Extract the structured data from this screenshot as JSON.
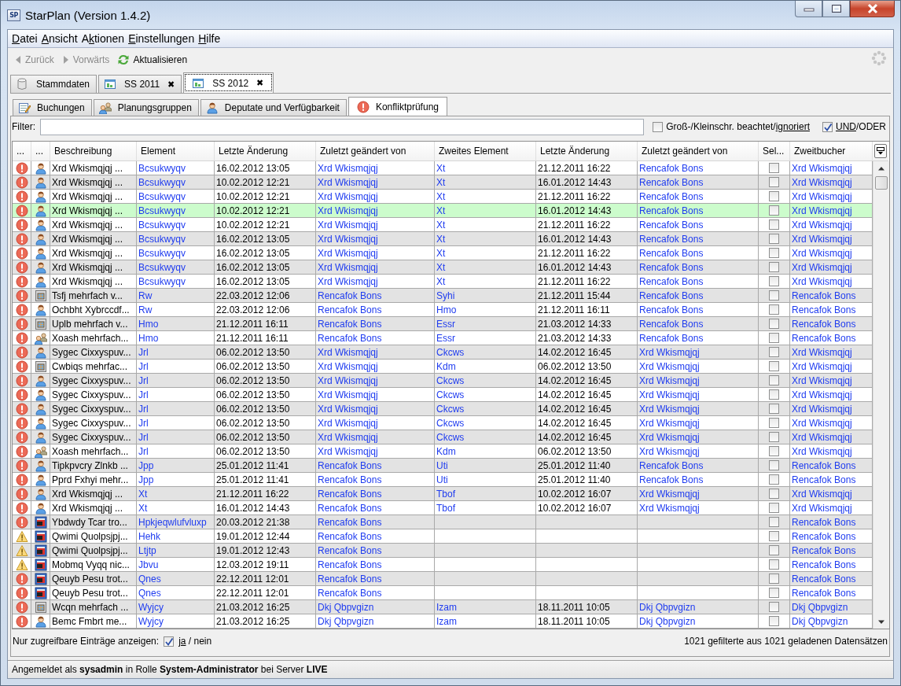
{
  "window": {
    "app_icon_text": "SP",
    "title": "StarPlan (Version 1.4.2)"
  },
  "menu": [
    {
      "parts": [
        {
          "text": "D",
          "underlined": true
        },
        {
          "text": "atei",
          "underlined": false
        }
      ]
    },
    {
      "parts": [
        {
          "text": "A",
          "underlined": true
        },
        {
          "text": "nsicht",
          "underlined": false
        }
      ]
    },
    {
      "parts": [
        {
          "text": "A",
          "underlined": false
        },
        {
          "text": "k",
          "underlined": true
        },
        {
          "text": "tionen",
          "underlined": false
        }
      ]
    },
    {
      "parts": [
        {
          "text": "E",
          "underlined": true
        },
        {
          "text": "instellungen",
          "underlined": false
        }
      ]
    },
    {
      "parts": [
        {
          "text": "H",
          "underlined": true
        },
        {
          "text": "ilfe",
          "underlined": false
        }
      ]
    }
  ],
  "toolbar": [
    {
      "label": "Zurück",
      "disabled": true
    },
    {
      "label": "Vorwärts",
      "disabled": true
    },
    {
      "label": "Aktualisieren",
      "disabled": false
    }
  ],
  "doc_tabs": [
    {
      "label": "Stammdaten",
      "selected": false
    },
    {
      "label": "SS 2011",
      "close": "✖",
      "selected": false
    },
    {
      "label": "SS 2012",
      "close": "✖",
      "selected": true
    }
  ],
  "sub_tabs": [
    {
      "label": "Buchungen",
      "selected": false
    },
    {
      "label": "Planungsgruppen",
      "selected": false
    },
    {
      "label": "Deputate und Verfügbarkeit",
      "selected": false
    },
    {
      "label": "Konfliktprüfung",
      "selected": true
    }
  ],
  "filter": {
    "label": "Filter:",
    "case_option": {
      "checked": false,
      "parts": [
        {
          "text": "Groß-/Kleinschr. beachtet/",
          "underlined": false
        },
        {
          "text": "ignoriert",
          "underlined": true
        }
      ]
    },
    "logic_option": {
      "checked": true,
      "parts": [
        {
          "text": "UND",
          "underlined": true
        },
        {
          "text": "/ODER",
          "underlined": false
        }
      ]
    }
  },
  "table": {
    "columns": [
      "...",
      "...",
      "Beschreibung",
      "Element",
      "Letzte Änderung",
      "Zuletzt geändert von",
      "Zweites Element",
      "Letzte Änderung",
      "Zuletzt geändert von",
      "Sel...",
      "Zweitbucher"
    ],
    "rows": [
      {
        "warning": false,
        "kind": "person",
        "description": "Xrd Wkismqjqj ...",
        "element": "Bcsukwyqv",
        "changed": "16.02.2012 13:05",
        "changed_by": "Xrd Wkismqjqj",
        "second_element": "Xt",
        "second_changed": "21.12.2011 16:22",
        "second_changed_by": "Rencafok Bons",
        "checked": false,
        "second_booker": "Xrd Wkismqjqj",
        "selected": false
      },
      {
        "warning": false,
        "kind": "person",
        "description": "Xrd Wkismqjqj ...",
        "element": "Bcsukwyqv",
        "changed": "10.02.2012 12:21",
        "changed_by": "Xrd Wkismqjqj",
        "second_element": "Xt",
        "second_changed": "16.01.2012 14:43",
        "second_changed_by": "Rencafok Bons",
        "checked": false,
        "second_booker": "Xrd Wkismqjqj",
        "selected": false
      },
      {
        "warning": false,
        "kind": "person",
        "description": "Xrd Wkismqjqj ...",
        "element": "Bcsukwyqv",
        "changed": "10.02.2012 12:21",
        "changed_by": "Xrd Wkismqjqj",
        "second_element": "Xt",
        "second_changed": "21.12.2011 16:22",
        "second_changed_by": "Rencafok Bons",
        "checked": false,
        "second_booker": "Xrd Wkismqjqj",
        "selected": false
      },
      {
        "warning": false,
        "kind": "person",
        "description": "Xrd Wkismqjqj ...",
        "element": "Bcsukwyqv",
        "changed": "10.02.2012 12:21",
        "changed_by": "Xrd Wkismqjqj",
        "second_element": "Xt",
        "second_changed": "16.01.2012 14:43",
        "second_changed_by": "Rencafok Bons",
        "checked": false,
        "second_booker": "Xrd Wkismqjqj",
        "selected": true
      },
      {
        "warning": false,
        "kind": "person",
        "description": "Xrd Wkismqjqj ...",
        "element": "Bcsukwyqv",
        "changed": "10.02.2012 12:21",
        "changed_by": "Xrd Wkismqjqj",
        "second_element": "Xt",
        "second_changed": "21.12.2011 16:22",
        "second_changed_by": "Rencafok Bons",
        "checked": false,
        "second_booker": "Xrd Wkismqjqj",
        "selected": false
      },
      {
        "warning": false,
        "kind": "person",
        "description": "Xrd Wkismqjqj ...",
        "element": "Bcsukwyqv",
        "changed": "16.02.2012 13:05",
        "changed_by": "Xrd Wkismqjqj",
        "second_element": "Xt",
        "second_changed": "16.01.2012 14:43",
        "second_changed_by": "Rencafok Bons",
        "checked": false,
        "second_booker": "Xrd Wkismqjqj",
        "selected": false
      },
      {
        "warning": false,
        "kind": "person",
        "description": "Xrd Wkismqjqj ...",
        "element": "Bcsukwyqv",
        "changed": "16.02.2012 13:05",
        "changed_by": "Xrd Wkismqjqj",
        "second_element": "Xt",
        "second_changed": "21.12.2011 16:22",
        "second_changed_by": "Rencafok Bons",
        "checked": false,
        "second_booker": "Xrd Wkismqjqj",
        "selected": false
      },
      {
        "warning": false,
        "kind": "person",
        "description": "Xrd Wkismqjqj ...",
        "element": "Bcsukwyqv",
        "changed": "16.02.2012 13:05",
        "changed_by": "Xrd Wkismqjqj",
        "second_element": "Xt",
        "second_changed": "16.01.2012 14:43",
        "second_changed_by": "Rencafok Bons",
        "checked": false,
        "second_booker": "Xrd Wkismqjqj",
        "selected": false
      },
      {
        "warning": false,
        "kind": "person",
        "description": "Xrd Wkismqjqj ...",
        "element": "Bcsukwyqv",
        "changed": "16.02.2012 13:05",
        "changed_by": "Xrd Wkismqjqj",
        "second_element": "Xt",
        "second_changed": "21.12.2011 16:22",
        "second_changed_by": "Rencafok Bons",
        "checked": false,
        "second_booker": "Xrd Wkismqjqj",
        "selected": false
      },
      {
        "warning": false,
        "kind": "room",
        "description": "Tsfj mehrfach v...",
        "element": "Rw",
        "changed": "22.03.2012 12:06",
        "changed_by": "Rencafok Bons",
        "second_element": "Syhi",
        "second_changed": "21.12.2011 15:44",
        "second_changed_by": "Rencafok Bons",
        "checked": false,
        "second_booker": "Rencafok Bons",
        "selected": false
      },
      {
        "warning": false,
        "kind": "person",
        "description": "Ochbht Xybrccdf...",
        "element": "Rw",
        "changed": "22.03.2012 12:06",
        "changed_by": "Rencafok Bons",
        "second_element": "Hmo",
        "second_changed": "21.12.2011 16:11",
        "second_changed_by": "Rencafok Bons",
        "checked": false,
        "second_booker": "Rencafok Bons",
        "selected": false
      },
      {
        "warning": false,
        "kind": "room",
        "description": "Uplb mehrfach v...",
        "element": "Hmo",
        "changed": "21.12.2011 16:11",
        "changed_by": "Rencafok Bons",
        "second_element": "Essr",
        "second_changed": "21.03.2012 14:33",
        "second_changed_by": "Rencafok Bons",
        "checked": false,
        "second_booker": "Rencafok Bons",
        "selected": false
      },
      {
        "warning": false,
        "kind": "group",
        "description": "Xoash mehrfach...",
        "element": "Hmo",
        "changed": "21.12.2011 16:11",
        "changed_by": "Rencafok Bons",
        "second_element": "Essr",
        "second_changed": "21.03.2012 14:33",
        "second_changed_by": "Rencafok Bons",
        "checked": false,
        "second_booker": "Rencafok Bons",
        "selected": false
      },
      {
        "warning": false,
        "kind": "person",
        "description": "Sygec Cixxyspuv...",
        "element": "Jrl",
        "changed": "06.02.2012 13:50",
        "changed_by": "Xrd Wkismqjqj",
        "second_element": "Ckcws",
        "second_changed": "14.02.2012 16:45",
        "second_changed_by": "Xrd Wkismqjqj",
        "checked": false,
        "second_booker": "Xrd Wkismqjqj",
        "selected": false
      },
      {
        "warning": false,
        "kind": "room",
        "description": "Cwbiqs mehrfac...",
        "element": "Jrl",
        "changed": "06.02.2012 13:50",
        "changed_by": "Xrd Wkismqjqj",
        "second_element": "Kdm",
        "second_changed": "06.02.2012 13:50",
        "second_changed_by": "Xrd Wkismqjqj",
        "checked": false,
        "second_booker": "Xrd Wkismqjqj",
        "selected": false
      },
      {
        "warning": false,
        "kind": "person",
        "description": "Sygec Cixxyspuv...",
        "element": "Jrl",
        "changed": "06.02.2012 13:50",
        "changed_by": "Xrd Wkismqjqj",
        "second_element": "Ckcws",
        "second_changed": "14.02.2012 16:45",
        "second_changed_by": "Xrd Wkismqjqj",
        "checked": false,
        "second_booker": "Xrd Wkismqjqj",
        "selected": false
      },
      {
        "warning": false,
        "kind": "person",
        "description": "Sygec Cixxyspuv...",
        "element": "Jrl",
        "changed": "06.02.2012 13:50",
        "changed_by": "Xrd Wkismqjqj",
        "second_element": "Ckcws",
        "second_changed": "14.02.2012 16:45",
        "second_changed_by": "Xrd Wkismqjqj",
        "checked": false,
        "second_booker": "Xrd Wkismqjqj",
        "selected": false
      },
      {
        "warning": false,
        "kind": "person",
        "description": "Sygec Cixxyspuv...",
        "element": "Jrl",
        "changed": "06.02.2012 13:50",
        "changed_by": "Xrd Wkismqjqj",
        "second_element": "Ckcws",
        "second_changed": "14.02.2012 16:45",
        "second_changed_by": "Xrd Wkismqjqj",
        "checked": false,
        "second_booker": "Xrd Wkismqjqj",
        "selected": false
      },
      {
        "warning": false,
        "kind": "person",
        "description": "Sygec Cixxyspuv...",
        "element": "Jrl",
        "changed": "06.02.2012 13:50",
        "changed_by": "Xrd Wkismqjqj",
        "second_element": "Ckcws",
        "second_changed": "14.02.2012 16:45",
        "second_changed_by": "Xrd Wkismqjqj",
        "checked": false,
        "second_booker": "Xrd Wkismqjqj",
        "selected": false
      },
      {
        "warning": false,
        "kind": "person",
        "description": "Sygec Cixxyspuv...",
        "element": "Jrl",
        "changed": "06.02.2012 13:50",
        "changed_by": "Xrd Wkismqjqj",
        "second_element": "Ckcws",
        "second_changed": "14.02.2012 16:45",
        "second_changed_by": "Xrd Wkismqjqj",
        "checked": false,
        "second_booker": "Xrd Wkismqjqj",
        "selected": false
      },
      {
        "warning": false,
        "kind": "group",
        "description": "Xoash mehrfach...",
        "element": "Jrl",
        "changed": "06.02.2012 13:50",
        "changed_by": "Xrd Wkismqjqj",
        "second_element": "Kdm",
        "second_changed": "06.02.2012 13:50",
        "second_changed_by": "Xrd Wkismqjqj",
        "checked": false,
        "second_booker": "Xrd Wkismqjqj",
        "selected": false
      },
      {
        "warning": false,
        "kind": "person",
        "description": "Tipkpvcry Zlnkb ...",
        "element": "Jpp",
        "changed": "25.01.2012 11:41",
        "changed_by": "Rencafok Bons",
        "second_element": "Uti",
        "second_changed": "25.01.2012 11:40",
        "second_changed_by": "Rencafok Bons",
        "checked": false,
        "second_booker": "Rencafok Bons",
        "selected": false
      },
      {
        "warning": false,
        "kind": "person",
        "description": "Pprd Fxhyi mehr...",
        "element": "Jpp",
        "changed": "25.01.2012 11:41",
        "changed_by": "Rencafok Bons",
        "second_element": "Uti",
        "second_changed": "25.01.2012 11:40",
        "second_changed_by": "Rencafok Bons",
        "checked": false,
        "second_booker": "Rencafok Bons",
        "selected": false
      },
      {
        "warning": false,
        "kind": "person",
        "description": "Xrd Wkismqjqj ...",
        "element": "Xt",
        "changed": "21.12.2011 16:22",
        "changed_by": "Rencafok Bons",
        "second_element": "Tbof",
        "second_changed": "10.02.2012 16:07",
        "second_changed_by": "Xrd Wkismqjqj",
        "checked": false,
        "second_booker": "Xrd Wkismqjqj",
        "selected": false
      },
      {
        "warning": false,
        "kind": "person",
        "description": "Xrd Wkismqjqj ...",
        "element": "Xt",
        "changed": "16.01.2012 14:43",
        "changed_by": "Rencafok Bons",
        "second_element": "Tbof",
        "second_changed": "10.02.2012 16:07",
        "second_changed_by": "Xrd Wkismqjqj",
        "checked": false,
        "second_booker": "Xrd Wkismqjqj",
        "selected": false
      },
      {
        "warning": false,
        "kind": "course",
        "description": "Ybdwdy Tcar tro...",
        "element": "Hpkjeqwlufvluxp",
        "changed": "20.03.2012 21:38",
        "changed_by": "Rencafok Bons",
        "checked": false,
        "second_booker": "Rencafok Bons",
        "selected": false
      },
      {
        "warning": true,
        "kind": "course",
        "description": "Qwimi Quolpsjpj...",
        "element": "Hehk",
        "changed": "19.01.2012 12:44",
        "changed_by": "Rencafok Bons",
        "checked": false,
        "second_booker": "Rencafok Bons",
        "selected": false
      },
      {
        "warning": true,
        "kind": "course",
        "description": "Qwimi Quolpsjpj...",
        "element": "Ltjtp",
        "changed": "19.01.2012 12:43",
        "changed_by": "Rencafok Bons",
        "checked": false,
        "second_booker": "Rencafok Bons",
        "selected": false
      },
      {
        "warning": true,
        "kind": "course",
        "description": "Mobmq Vyqq nic...",
        "element": "Jbvu",
        "changed": "12.03.2012 19:11",
        "changed_by": "Rencafok Bons",
        "checked": false,
        "second_booker": "Rencafok Bons",
        "selected": false
      },
      {
        "warning": false,
        "kind": "course",
        "description": "Qeuyb Pesu trot...",
        "element": "Qnes",
        "changed": "22.12.2011 12:01",
        "changed_by": "Rencafok Bons",
        "checked": false,
        "second_booker": "Rencafok Bons",
        "selected": false
      },
      {
        "warning": false,
        "kind": "course",
        "description": "Qeuyb Pesu trot...",
        "element": "Qnes",
        "changed": "22.12.2011 12:01",
        "changed_by": "Rencafok Bons",
        "checked": false,
        "second_booker": "Rencafok Bons",
        "selected": false
      },
      {
        "warning": false,
        "kind": "room",
        "description": "Wcqn mehrfach ...",
        "element": "Wyjcy",
        "changed": "21.03.2012 16:25",
        "changed_by": "Dkj Qbpvgizn",
        "second_element": "Izam",
        "second_changed": "18.11.2011 10:05",
        "second_changed_by": "Dkj Qbpvgizn",
        "checked": false,
        "second_booker": "Dkj Qbpvgizn",
        "selected": false
      },
      {
        "warning": false,
        "kind": "person",
        "description": "Bemc Fmbrt me...",
        "element": "Wyjcy",
        "changed": "21.03.2012 16:25",
        "changed_by": "Dkj Qbpvgizn",
        "second_element": "Izam",
        "second_changed": "18.11.2011 10:05",
        "second_changed_by": "Dkj Qbpvgizn",
        "checked": false,
        "second_booker": "Dkj Qbpvgizn",
        "selected": false
      }
    ]
  },
  "footer": {
    "label": "Nur zugreifbare Einträge anzeigen:",
    "checked": true,
    "parts": [
      {
        "text": "ja",
        "underlined": true
      },
      {
        "text": " / nein",
        "underlined": false
      }
    ],
    "count": "1021 gefilterte aus 1021 geladenen Datensätzen"
  },
  "status_bar": "Angemeldet als **sysadmin** in Rolle **System-Administrator** bei Server **LIVE**"
}
